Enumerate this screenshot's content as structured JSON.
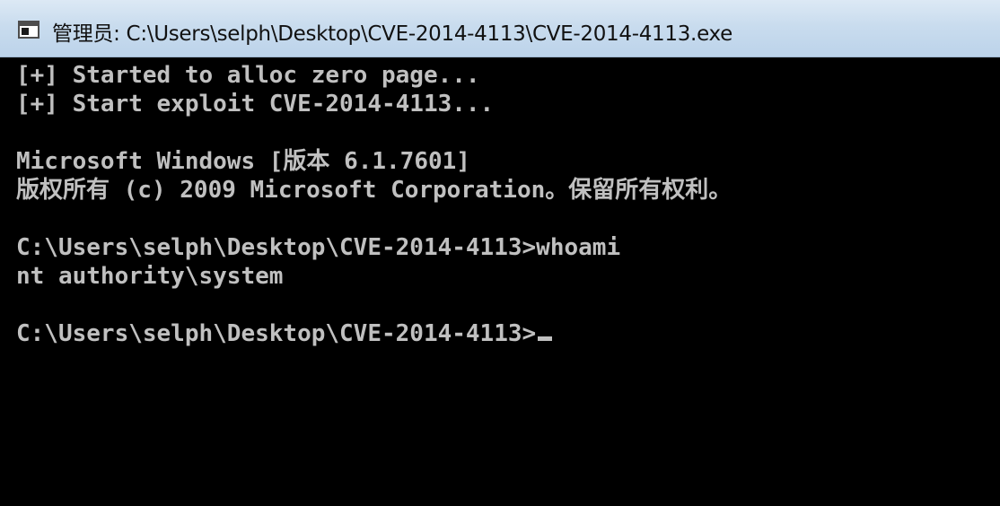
{
  "window": {
    "title": "管理员: C:\\Users\\selph\\Desktop\\CVE-2014-4113\\CVE-2014-4113.exe",
    "icon": "console-window-icon"
  },
  "console": {
    "lines": [
      "[+] Started to alloc zero page...",
      "[+] Start exploit CVE-2014-4113...",
      "Microsoft Windows [版本 6.1.7601]",
      "版权所有 (c) 2009 Microsoft Corporation。保留所有权利。",
      "C:\\Users\\selph\\Desktop\\CVE-2014-4113>whoami",
      "nt authority\\system",
      "C:\\Users\\selph\\Desktop\\CVE-2014-4113>"
    ]
  },
  "colors": {
    "console_bg": "#000000",
    "console_text": "#c0c0c0",
    "titlebar": "#c9dcee"
  }
}
